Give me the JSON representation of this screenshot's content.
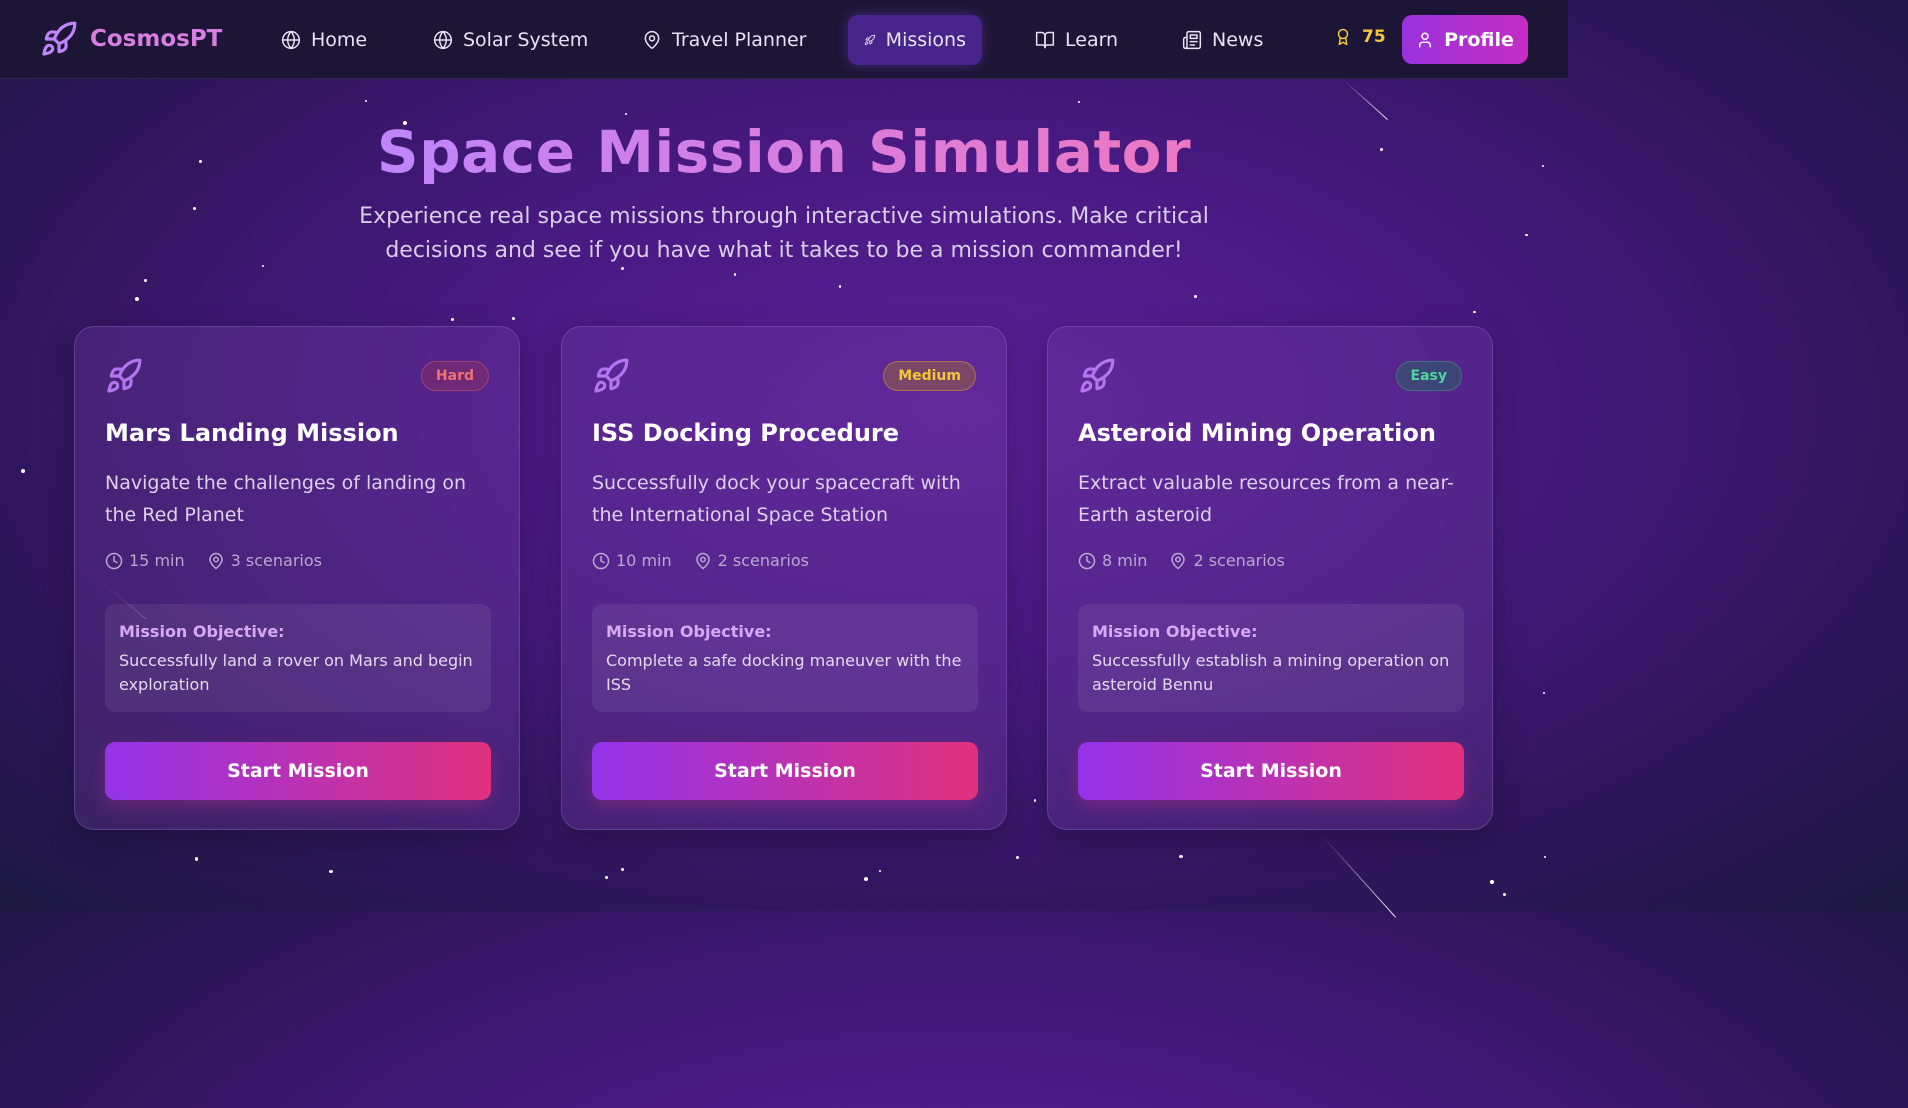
{
  "nav": {
    "brand": "CosmosPT",
    "items": [
      {
        "label": "Home",
        "icon": "globe-icon"
      },
      {
        "label": "Solar System",
        "icon": "globe-icon"
      },
      {
        "label": "Travel Planner",
        "icon": "map-pin-icon"
      },
      {
        "label": "Missions",
        "icon": "rocket-icon",
        "active": true
      },
      {
        "label": "Learn",
        "icon": "book-icon"
      },
      {
        "label": "News",
        "icon": "newspaper-icon"
      }
    ],
    "points": "75",
    "profile_label": "Profile"
  },
  "hero": {
    "title": "Space Mission Simulator",
    "subtitle": "Experience real space missions through interactive simulations. Make critical decisions and see if you have what it takes to be a mission commander!"
  },
  "missions": [
    {
      "difficulty": "Hard",
      "title": "Mars Landing Mission",
      "description": "Navigate the challenges of landing on the Red Planet",
      "duration": "15 min",
      "scenarios": "3 scenarios",
      "objective_label": "Mission Objective:",
      "objective": "Successfully land a rover on Mars and begin exploration",
      "button": "Start Mission"
    },
    {
      "difficulty": "Medium",
      "title": "ISS Docking Procedure",
      "description": "Successfully dock your spacecraft with the International Space Station",
      "duration": "10 min",
      "scenarios": "2 scenarios",
      "objective_label": "Mission Objective:",
      "objective": "Complete a safe docking maneuver with the ISS",
      "button": "Start Mission"
    },
    {
      "difficulty": "Easy",
      "title": "Asteroid Mining Operation",
      "description": "Extract valuable resources from a near-Earth asteroid",
      "duration": "8 min",
      "scenarios": "2 scenarios",
      "objective_label": "Mission Objective:",
      "objective": "Successfully establish a mining operation on asteroid Bennu",
      "button": "Start Mission"
    }
  ],
  "colors": {
    "brand": "#d67fe0",
    "accent_start": "#9333ea",
    "accent_end": "#e0317d",
    "points": "#f5c53a",
    "hard": "#f07272",
    "medium": "#f5c53a",
    "easy": "#4fd6a0"
  }
}
